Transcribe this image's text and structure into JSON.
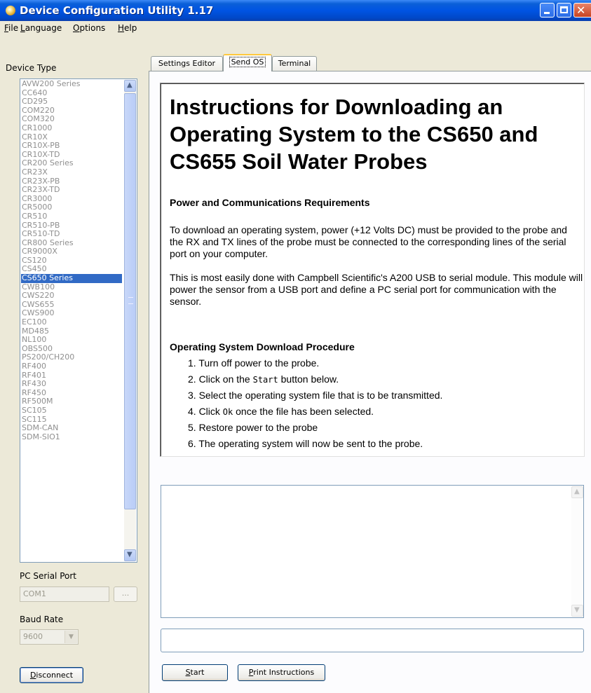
{
  "window": {
    "title": "Device Configuration Utility 1.17"
  },
  "menu": [
    {
      "key": "F",
      "rest": "ile"
    },
    {
      "key": "L",
      "rest": "anguage"
    },
    {
      "key": "O",
      "rest": "ptions"
    },
    {
      "key": "H",
      "rest": "elp"
    }
  ],
  "sidebar": {
    "device_type_label": "Device Type",
    "devices": [
      "AVW200 Series",
      "CC640",
      "CD295",
      "COM220",
      "COM320",
      "CR1000",
      "CR10X",
      "CR10X-PB",
      "CR10X-TD",
      "CR200 Series",
      "CR23X",
      "CR23X-PB",
      "CR23X-TD",
      "CR3000",
      "CR5000",
      "CR510",
      "CR510-PB",
      "CR510-TD",
      "CR800 Series",
      "CR9000X",
      "CS120",
      "CS450",
      "CS650 Series",
      "CWB100",
      "CWS220",
      "CWS655",
      "CWS900",
      "EC100",
      "MD485",
      "NL100",
      "OBS500",
      "PS200/CH200",
      "RF400",
      "RF401",
      "RF430",
      "RF450",
      "RF500M",
      "SC105",
      "SC115",
      "SDM-CAN",
      "SDM-SIO1"
    ],
    "selected_device": "CS650 Series",
    "pc_serial_port_label": "PC Serial Port",
    "serial_port_value": "COM1",
    "browse_label": "...",
    "baud_rate_label": "Baud Rate",
    "baud_rate_value": "9600",
    "disconnect_key": "D",
    "disconnect_rest": "isconnect"
  },
  "tabs": [
    "Settings Editor",
    "Send OS",
    "Terminal"
  ],
  "active_tab": "Send OS",
  "instructions": {
    "title": "Instructions for Downloading an Operating System to the CS650 and CS655 Soil Water Probes",
    "section1_heading": "Power and Communications Requirements",
    "para1": "To download an operating system, power (+12 Volts DC) must be provided to the probe and the RX and TX lines of the probe must be connected to the corresponding lines of the serial port on your computer.",
    "para2": "This is most easily done with Campbell Scientific's A200 USB to serial module. This module will power the sensor from a USB port and define a PC serial port for communication with the sensor.",
    "section2_heading": "Operating System Download Procedure",
    "steps": {
      "s1": "1. Turn off power to the probe.",
      "s2_pre": "2. Click on the ",
      "s2_code": "Start",
      "s2_post": " button below.",
      "s3": "3. Select the operating system file that is to be transmitted.",
      "s4_pre": "4. Click ",
      "s4_code": "Ok",
      "s4_post": " once the file has been selected.",
      "s5": "5. Restore power to the probe",
      "s6": "6. The operating system will now be sent to the probe."
    }
  },
  "buttons": {
    "start_key": "S",
    "start_rest": "tart",
    "print_key": "P",
    "print_rest": "rint Instructions"
  },
  "icons": {
    "app": "app-icon",
    "minimize": "minimize-icon",
    "maximize": "maximize-icon",
    "close": "close-icon",
    "scroll_up": "scroll-up-icon",
    "scroll_down": "scroll-down-icon"
  },
  "colors": {
    "titlebar": "#0054e3",
    "selection": "#316ac5",
    "disabled_text": "#8f8f8f",
    "tab_highlight": "#ffc83c"
  }
}
